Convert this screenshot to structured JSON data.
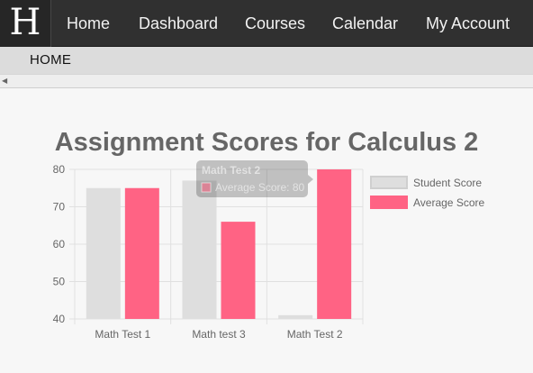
{
  "logo": {
    "letter": "H"
  },
  "nav": {
    "items": [
      {
        "label": "Home"
      },
      {
        "label": "Dashboard"
      },
      {
        "label": "Courses"
      },
      {
        "label": "Calendar"
      },
      {
        "label": "My Account"
      }
    ]
  },
  "breadcrumb": {
    "label": "HOME"
  },
  "scroll": {
    "left_arrow_icon": "triangle-left-icon"
  },
  "colors": {
    "nav_bg": "#303030",
    "student": "#dedede",
    "average": "#ff6384"
  },
  "chart_data": {
    "type": "bar",
    "title": "Assignment Scores for Calculus 2",
    "categories": [
      "Math Test 1",
      "Math test 3",
      "Math Test 2"
    ],
    "series": [
      {
        "name": "Student Score",
        "values": [
          75,
          77,
          41
        ],
        "color": "#dedede"
      },
      {
        "name": "Average Score",
        "values": [
          75,
          66,
          80
        ],
        "color": "#ff6384"
      }
    ],
    "ylim": [
      40,
      80
    ],
    "yticks": [
      40,
      50,
      60,
      70,
      80
    ],
    "grid": true,
    "legend": "right",
    "tooltip": {
      "title": "Math Test 2",
      "series": "Average Score",
      "value": 80,
      "text": "Average Score: 80"
    }
  }
}
